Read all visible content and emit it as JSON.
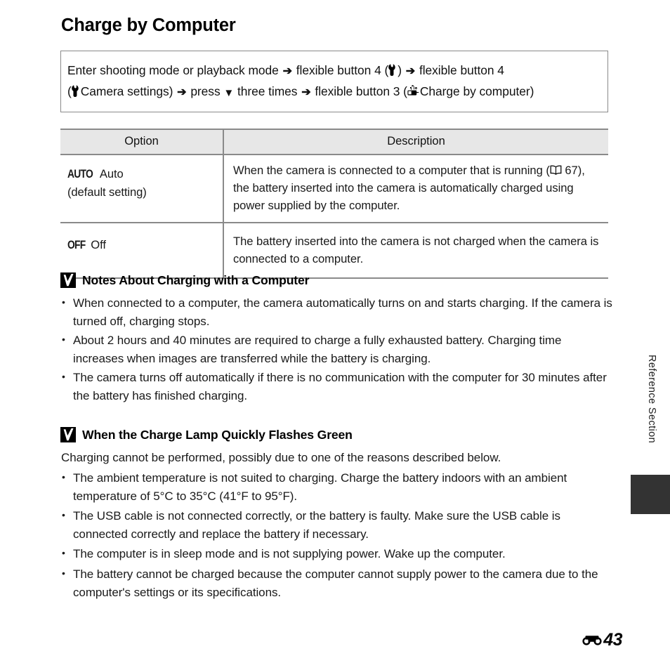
{
  "page": {
    "title": "Charge by Computer",
    "number": "43",
    "section_marker_icon": "reference-section-icon",
    "side_tab_label": "Reference Section"
  },
  "instruction": {
    "line1_part1": "Enter shooting mode or playback mode",
    "arrow": "➔",
    "line1_part2": "flexible button 4 (",
    "line1_icon": "wrench-icon",
    "line1_part3": ")",
    "line1_part4": "flexible button 4",
    "line2_part1": "(",
    "line2_icon": "wrench-icon",
    "line2_part2": "Camera settings)",
    "line2_part3": "press",
    "line2_dpad_icon": "down-triangle-icon",
    "line2_part4": "three times",
    "line2_part5": "flexible button 3 (",
    "line2_usb_icon": "charge-by-computer-icon",
    "line2_part6": "Charge by computer)"
  },
  "table": {
    "headers": [
      "Option",
      "Description"
    ],
    "rows": [
      {
        "mark": "AUTO",
        "name": "Auto",
        "sub": "(default setting)",
        "desc_pre": "When the camera is connected to a computer that is running (",
        "desc_ref_icon": "book-icon",
        "desc_ref_page": "67),",
        "desc_post": "the battery inserted into the camera is automatically charged using power supplied by the computer."
      },
      {
        "mark": "OFF",
        "name": "Off",
        "sub": "",
        "desc_pre": "The battery inserted into the camera is not charged when the camera is connected to a computer.",
        "desc_ref_icon": "",
        "desc_ref_page": "",
        "desc_post": ""
      }
    ]
  },
  "notes_charging": {
    "icon": "warning-check-icon",
    "title": "Notes About Charging with a Computer",
    "items": [
      "When connected to a computer, the camera automatically turns on and starts charging. If the camera is turned off, charging stops.",
      "About 2 hours and 40 minutes are required to charge a fully exhausted battery. Charging time increases when images are transferred while the battery is charging.",
      "The camera turns off automatically if there is no communication with the computer for 30 minutes after the battery has finished charging."
    ]
  },
  "notes_lamp": {
    "icon": "warning-check-icon",
    "title": "When the Charge Lamp Quickly Flashes Green",
    "intro": "Charging cannot be performed, possibly due to one of the reasons described below.",
    "items": [
      "The ambient temperature is not suited to charging. Charge the battery indoors with an ambient temperature of 5°C to 35°C (41°F to 95°F).",
      "The USB cable is not connected correctly, or the battery is faulty. Make sure the USB cable is connected correctly and replace the battery if necessary.",
      "The computer is in sleep mode and is not supplying power. Wake up the computer.",
      "The battery cannot be charged because the computer cannot supply power to the camera due to the computer's settings or its specifications."
    ]
  },
  "colors": {
    "rule": "#8a8a8a",
    "header_bg": "#e7e7e7",
    "tab_block": "#333333",
    "text": "#1a1a1a"
  }
}
